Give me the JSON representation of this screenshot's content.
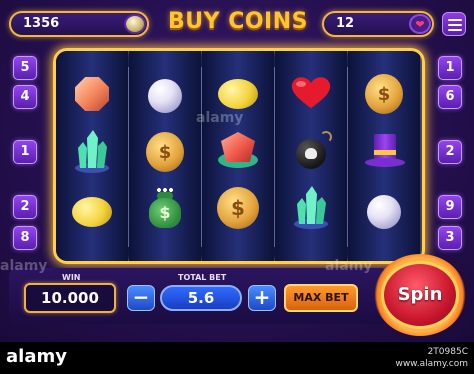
{
  "header": {
    "coin_balance": "1356",
    "title": "BUY COINS",
    "lives": "12"
  },
  "reels": [
    [
      "orange-gem",
      "crystal",
      "lemon"
    ],
    [
      "pearl",
      "gold-coin",
      "money-bag"
    ],
    [
      "lemon",
      "red-gem",
      "gold-coin"
    ],
    [
      "heart",
      "skull-bomb",
      "crystal"
    ],
    [
      "gold-coin",
      "magic-hat",
      "pearl"
    ]
  ],
  "symbols": {
    "coin_glyph": "$",
    "bag_glyph": "$"
  },
  "paylines": {
    "left": [
      "5",
      "4",
      "1",
      "2",
      "8"
    ],
    "right": [
      "1",
      "6",
      "2",
      "9",
      "3"
    ]
  },
  "controls": {
    "win_label": "WIN",
    "win_value": "10.000",
    "total_bet_label": "TOTAL BET",
    "bet_value": "5.6",
    "minus_label": "−",
    "plus_label": "+",
    "max_bet_label": "MAX BET",
    "spin_label": "Spin"
  },
  "watermark": {
    "brand": "alamy",
    "image_id": "2T0985C",
    "stock_line": "www.alamy.com"
  },
  "colors": {
    "accent_gold": "#ffc531",
    "background": "#25104f",
    "spin_red": "#c8172e",
    "bet_blue": "#1a3ec2"
  }
}
